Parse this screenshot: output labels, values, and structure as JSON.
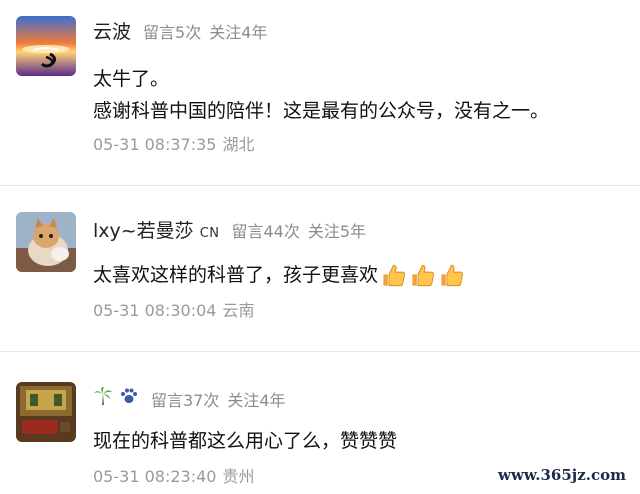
{
  "comments": [
    {
      "nickname": "云波",
      "message_count": "留言5次",
      "follow_years": "关注4年",
      "lines": [
        "太牛了。",
        "感谢科普中国的陪伴！这是最有的公众号，没有之一。"
      ],
      "time": "05-31 08:37:35",
      "location": "湖北"
    },
    {
      "nickname": "lxy~若曼莎",
      "badge": "CN",
      "message_count": "留言44次",
      "follow_years": "关注5年",
      "lines": [
        "太喜欢这样的科普了，孩子更喜欢"
      ],
      "time": "05-31 08:30:04",
      "location": "云南"
    },
    {
      "nickname_icons": [
        "palm-tree-icon",
        "paw-prints-icon"
      ],
      "message_count": "留言37次",
      "follow_years": "关注4年",
      "lines": [
        "现在的科普都这么用心了么，赞赞赞"
      ],
      "time": "05-31 08:23:40",
      "location": "贵州"
    }
  ],
  "watermark": "www.365jz.com",
  "colors": {
    "meta": "#8c8c8c",
    "time": "#9a9a9a",
    "divider": "#e6e6e6",
    "text": "#111111"
  }
}
